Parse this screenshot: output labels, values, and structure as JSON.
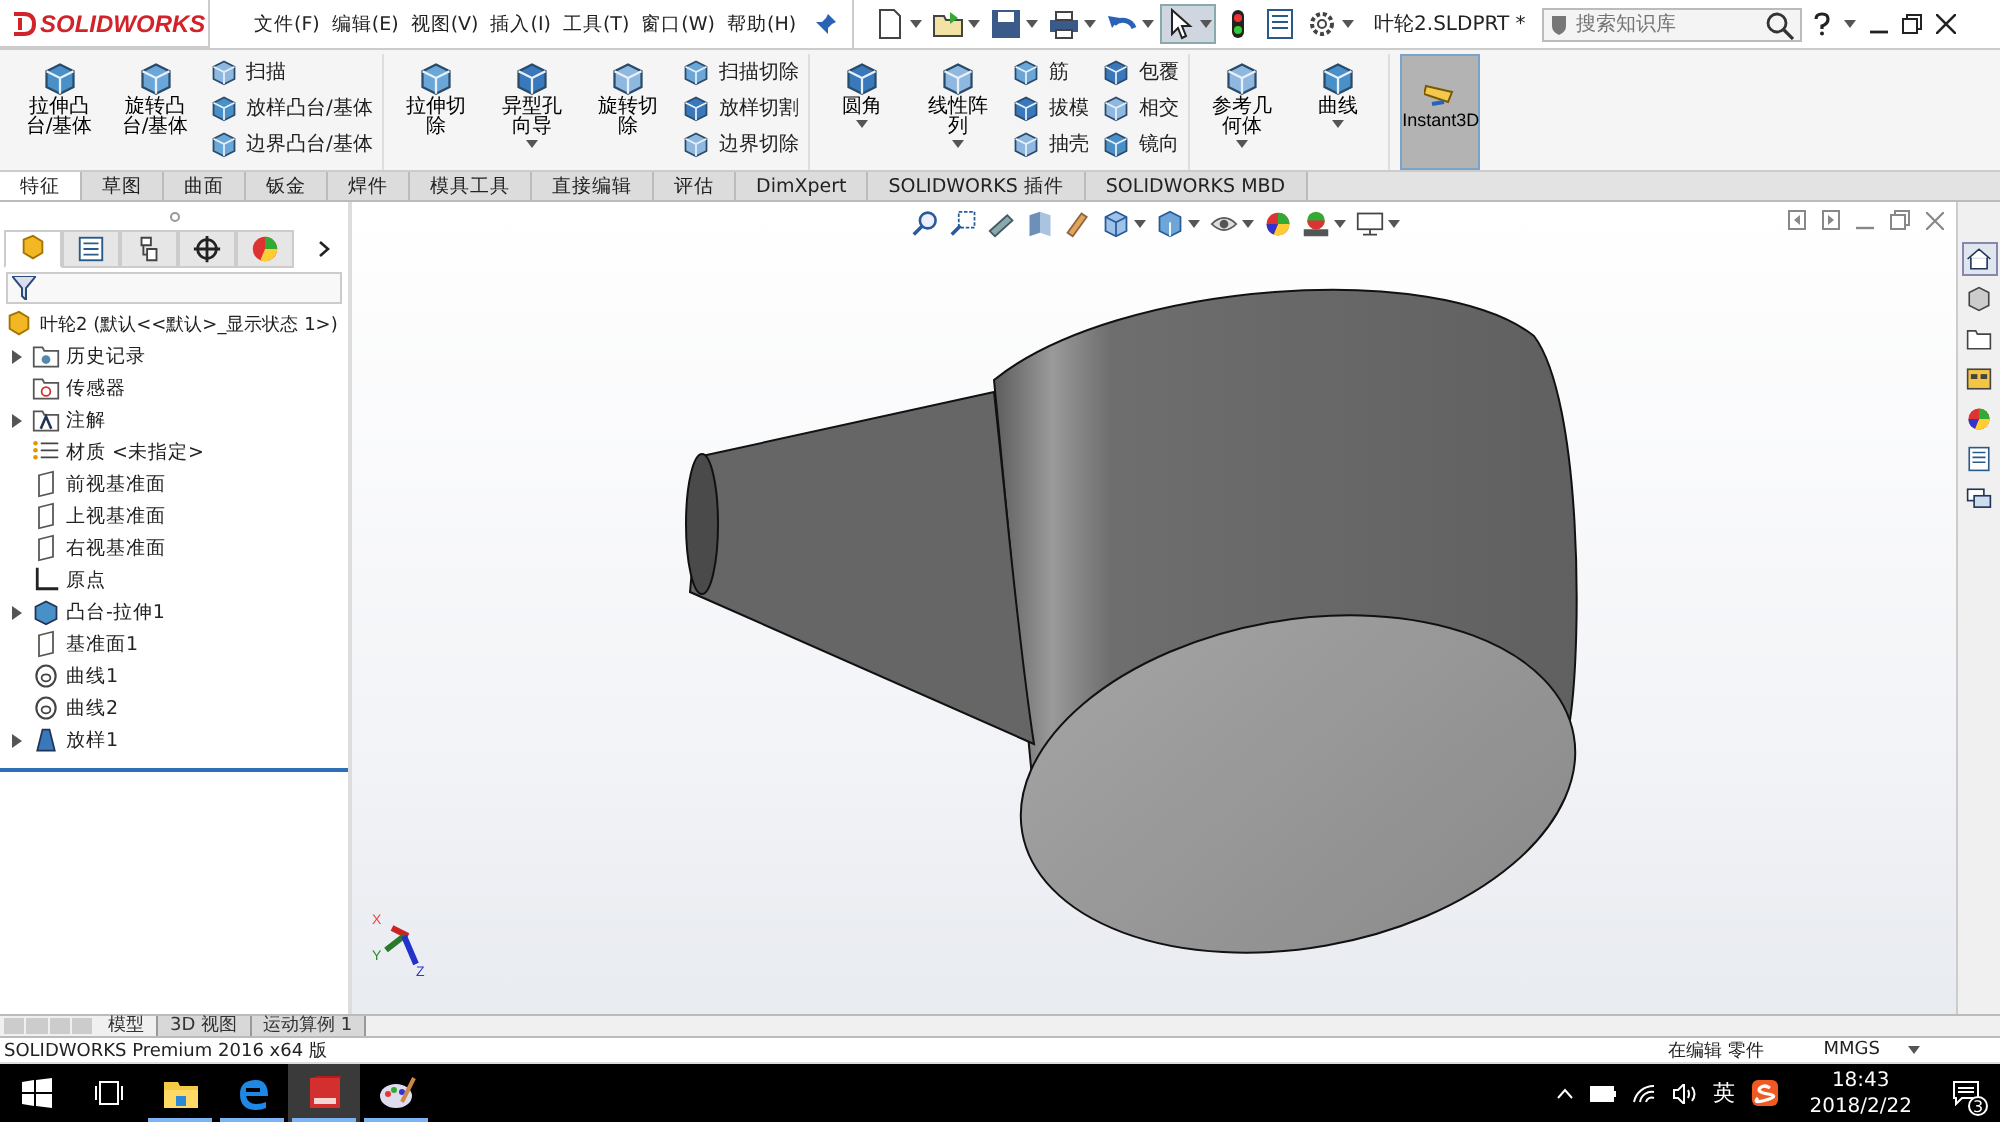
{
  "menu_bar": {
    "logo": "SOLIDWORKS",
    "menus": [
      "文件(F)",
      "编辑(E)",
      "视图(V)",
      "插入(I)",
      "工具(T)",
      "窗口(W)",
      "帮助(H)"
    ],
    "document_title": "叶轮2.SLDPRT *",
    "search": {
      "placeholder": "搜索知识库"
    }
  },
  "quick_toolbar": [
    {
      "kind": "new",
      "dropdown": true,
      "selected": false
    },
    {
      "kind": "open",
      "dropdown": true,
      "selected": false
    },
    {
      "kind": "save",
      "dropdown": true,
      "selected": false
    },
    {
      "kind": "print",
      "dropdown": true,
      "selected": false
    },
    {
      "kind": "undo",
      "dropdown": true,
      "selected": false
    },
    {
      "kind": "select",
      "dropdown": true,
      "selected": true
    },
    {
      "kind": "rebuild",
      "dropdown": false,
      "selected": false
    },
    {
      "kind": "properties",
      "dropdown": false,
      "selected": false
    },
    {
      "kind": "options",
      "dropdown": true,
      "selected": false
    }
  ],
  "ribbon": {
    "groups": [
      {
        "items": [
          {
            "kind": "large",
            "label": "拉伸凸台/基体",
            "dropdown": false,
            "selected": false
          },
          {
            "kind": "large",
            "label": "旋转凸台/基体",
            "dropdown": false,
            "selected": false
          },
          {
            "kind": "small",
            "labels": [
              "扫描",
              "放样凸台/基体",
              "边界凸台/基体"
            ]
          }
        ]
      },
      {
        "items": [
          {
            "kind": "large",
            "label": "拉伸切除",
            "dropdown": false,
            "selected": false
          },
          {
            "kind": "large",
            "label": "异型孔向导",
            "dropdown": true,
            "selected": false
          },
          {
            "kind": "large",
            "label": "旋转切除",
            "dropdown": false,
            "selected": false
          },
          {
            "kind": "small",
            "labels": [
              "扫描切除",
              "放样切割",
              "边界切除"
            ]
          }
        ]
      },
      {
        "items": [
          {
            "kind": "large",
            "label": "圆角",
            "dropdown": true,
            "selected": false
          },
          {
            "kind": "large",
            "label": "线性阵列",
            "dropdown": true,
            "selected": false
          },
          {
            "kind": "small",
            "labels": [
              "筋",
              "拔模",
              "抽壳"
            ]
          },
          {
            "kind": "small",
            "labels": [
              "包覆",
              "相交",
              "镜向"
            ]
          }
        ]
      },
      {
        "items": [
          {
            "kind": "large",
            "label": "参考几何体",
            "dropdown": true,
            "selected": false
          },
          {
            "kind": "large",
            "label": "曲线",
            "dropdown": true,
            "selected": false
          }
        ]
      },
      {
        "items": [
          {
            "kind": "large",
            "label": "Instant3D",
            "dropdown": false,
            "selected": true
          }
        ]
      }
    ]
  },
  "command_tabs": [
    {
      "label": "特征",
      "selected": true
    },
    {
      "label": "草图",
      "selected": false
    },
    {
      "label": "曲面",
      "selected": false
    },
    {
      "label": "钣金",
      "selected": false
    },
    {
      "label": "焊件",
      "selected": false
    },
    {
      "label": "模具工具",
      "selected": false
    },
    {
      "label": "直接编辑",
      "selected": false
    },
    {
      "label": "评估",
      "selected": false
    },
    {
      "label": "DimXpert",
      "selected": false
    },
    {
      "label": "SOLIDWORKS 插件",
      "selected": false
    },
    {
      "label": "SOLIDWORKS MBD",
      "selected": false
    }
  ],
  "panel_tabs": [
    {
      "kind": "feature-manager",
      "selected": true
    },
    {
      "kind": "property-manager",
      "selected": false
    },
    {
      "kind": "configuration",
      "selected": false
    },
    {
      "kind": "dimxpert",
      "selected": false
    },
    {
      "kind": "display",
      "selected": false
    }
  ],
  "feature_tree": {
    "label": "叶轮2 (默认<<默认>_显示状态 1>)",
    "children": [
      {
        "kind": "history",
        "label": "历史记录",
        "expandable": true
      },
      {
        "kind": "sensor",
        "label": "传感器",
        "expandable": false
      },
      {
        "kind": "annotation",
        "label": "注解",
        "expandable": true
      },
      {
        "kind": "material",
        "label": "材质 <未指定>",
        "expandable": false
      },
      {
        "kind": "plane",
        "label": "前视基准面",
        "expandable": false
      },
      {
        "kind": "plane",
        "label": "上视基准面",
        "expandable": false
      },
      {
        "kind": "plane",
        "label": "右视基准面",
        "expandable": false
      },
      {
        "kind": "origin",
        "label": "原点",
        "expandable": false
      },
      {
        "kind": "extrude",
        "label": "凸台-拉伸1",
        "expandable": true
      },
      {
        "kind": "plane",
        "label": "基准面1",
        "expandable": false
      },
      {
        "kind": "curve",
        "label": "曲线1",
        "expandable": false
      },
      {
        "kind": "curve",
        "label": "曲线2",
        "expandable": false
      },
      {
        "kind": "loft",
        "label": "放样1",
        "expandable": true
      }
    ]
  },
  "view_toolbar": [
    {
      "kind": "zoom-fit",
      "dropdown": false
    },
    {
      "kind": "zoom-area",
      "dropdown": false
    },
    {
      "kind": "previous-view",
      "dropdown": false
    },
    {
      "kind": "section",
      "dropdown": false
    },
    {
      "kind": "annotation",
      "dropdown": false
    },
    {
      "kind": "orientation",
      "dropdown": true
    },
    {
      "kind": "display-style",
      "dropdown": true
    },
    {
      "kind": "hide-show",
      "dropdown": true
    },
    {
      "kind": "appearance",
      "dropdown": false
    },
    {
      "kind": "scene",
      "dropdown": true
    },
    {
      "kind": "display-settings",
      "dropdown": true
    }
  ],
  "task_pane": [
    {
      "kind": "home",
      "selected": true
    },
    {
      "kind": "parts",
      "selected": false
    },
    {
      "kind": "folder",
      "selected": false
    },
    {
      "kind": "view-palette",
      "selected": false
    },
    {
      "kind": "appearance",
      "selected": false
    },
    {
      "kind": "properties",
      "selected": false
    },
    {
      "kind": "forum",
      "selected": false
    }
  ],
  "triad": {
    "x": "X",
    "y": "Y",
    "z": "Z"
  },
  "bottom_tabs": [
    {
      "label": "模型",
      "selected": true
    },
    {
      "label": "3D 视图",
      "selected": false
    },
    {
      "label": "运动算例 1",
      "selected": false
    }
  ],
  "status_bar": {
    "product": "SOLIDWORKS Premium 2016 x64 版",
    "mode": "在编辑 零件",
    "units": "MMGS"
  },
  "taskbar": {
    "apps": [
      {
        "kind": "start",
        "running": false,
        "selected": false
      },
      {
        "kind": "task-view",
        "running": false,
        "selected": false
      },
      {
        "kind": "explorer",
        "running": true,
        "selected": false
      },
      {
        "kind": "edge",
        "running": true,
        "selected": false
      },
      {
        "kind": "solidworks",
        "running": true,
        "selected": true
      },
      {
        "kind": "paint",
        "running": true,
        "selected": false
      }
    ],
    "ime": "英",
    "time": "18:43",
    "date": "2018/2/22",
    "notifications": "3"
  }
}
